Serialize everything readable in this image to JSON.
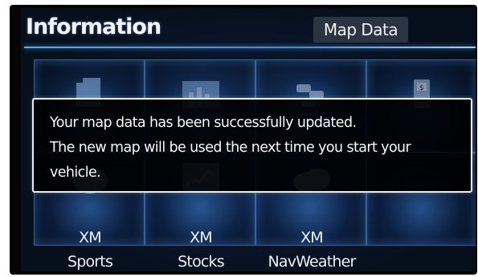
{
  "header": {
    "title": "Information",
    "map_data_button": "Map Data"
  },
  "tiles": [
    {
      "icon": "folder-icon",
      "line1": "",
      "line2": ""
    },
    {
      "icon": "bar-chart-icon",
      "line1": "",
      "line2": ""
    },
    {
      "icon": "traffic-icon",
      "line1": "",
      "line2": ""
    },
    {
      "icon": "fuel-price-icon",
      "line1": "",
      "line2": ""
    },
    {
      "icon": "sports-icon",
      "line1": "XM",
      "line2": "Sports"
    },
    {
      "icon": "stocks-icon",
      "line1": "XM",
      "line2": "Stocks"
    },
    {
      "icon": "weather-cloud-icon",
      "line1": "XM",
      "line2": "NavWeather"
    },
    {
      "icon": "",
      "line1": "",
      "line2": ""
    }
  ],
  "dialog": {
    "line1": "Your map data has been successfully updated.",
    "line2": "The new map will be used the next time you start your",
    "line3": "vehicle."
  },
  "colors": {
    "accent": "#4a9cff",
    "background": "#06101d",
    "dialog_border": "#e8ecf2"
  }
}
